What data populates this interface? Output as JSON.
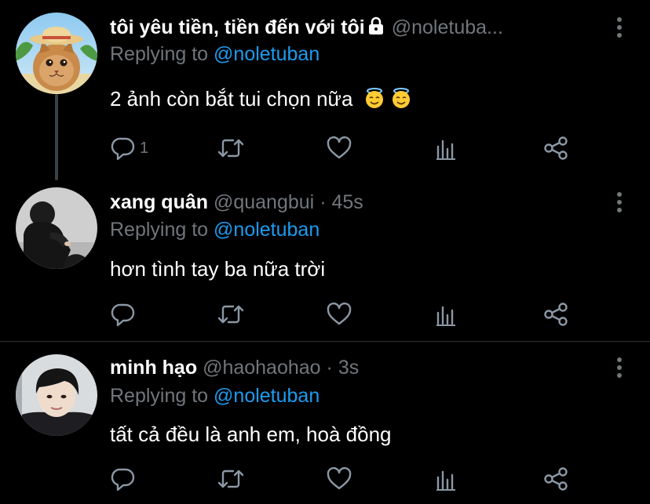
{
  "tweets": [
    {
      "name": "tôi yêu tiền, tiền đến với tôi",
      "handle": "@noletuba...",
      "separator": "",
      "time": "",
      "replying_prefix": "Replying to",
      "replying_to": "@noletuban",
      "text": "2 ảnh còn bắt tui chọn nữa",
      "reply_count": "1",
      "avatar": "cat-with-straw-hat"
    },
    {
      "name": "xang quân",
      "handle": "@quangbui",
      "separator": "·",
      "time": "45s",
      "replying_prefix": "Replying to",
      "replying_to": "@noletuban",
      "text": "hơn tình tay ba nữa trời",
      "reply_count": "",
      "avatar": "person-in-dark-hoodie"
    },
    {
      "name": "minh hạo",
      "handle": "@haohaohao",
      "separator": "·",
      "time": "3s",
      "replying_prefix": "Replying to",
      "replying_to": "@noletuban",
      "text": "tất cả đều là anh em, hoà đồng",
      "reply_count": "",
      "avatar": "young-man-portrait"
    }
  ],
  "colors": {
    "background": "#000000",
    "text": "#ffffff",
    "muted": "#71767b",
    "accent": "#1d9bf0",
    "divider": "#2f3336"
  },
  "icons": [
    "lock-icon",
    "more-icon",
    "reply-icon",
    "retweet-icon",
    "like-icon",
    "analytics-icon",
    "share-icon",
    "smiling-face-with-halo-emoji"
  ]
}
